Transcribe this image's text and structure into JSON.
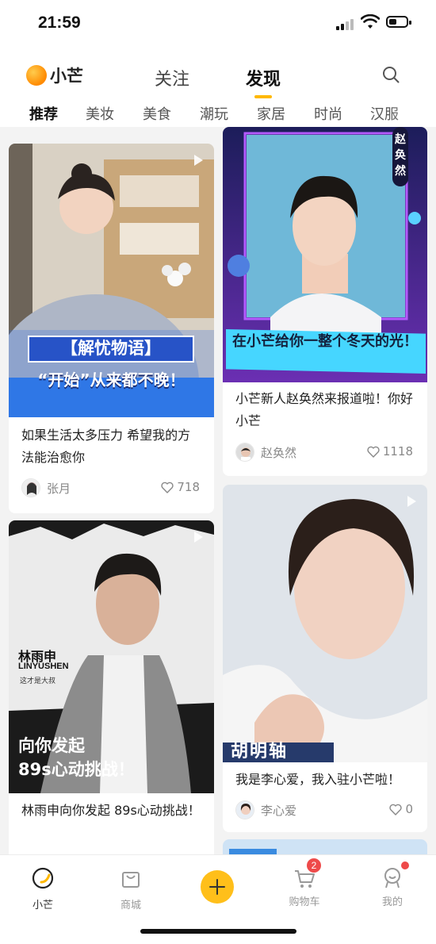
{
  "status": {
    "time": "21:59"
  },
  "app": {
    "logo_text": "小芒",
    "brand_color": "#ffb800"
  },
  "topnav": {
    "follow": "关注",
    "discover": "发现"
  },
  "categories": [
    "推荐",
    "美妆",
    "美食",
    "潮玩",
    "家居",
    "时尚",
    "汉服"
  ],
  "posts": [
    {
      "title": "如果生活太多压力 希望我的方法能治愈你",
      "user": "张月",
      "likes": "718",
      "overlay_top": "【解忧物语】",
      "overlay_bottom": "“开始”从来都不晚！"
    },
    {
      "title": "小芒新人赵奂然来报道啦！你好小芒",
      "user": "赵奂然",
      "likes": "1118",
      "overlay_side": "赵奂然",
      "overlay_bottom": "在小芒给你一整个冬天的光！"
    },
    {
      "title": "林雨申向你发起 89s心动挑战！",
      "user": "",
      "likes": "",
      "overlay_name": "林雨申",
      "overlay_en": "LINYUSHEN",
      "overlay_sub": "这才是大叔",
      "overlay_line1": "向你发起",
      "overlay_line2": "89s心动挑战！"
    },
    {
      "title": "我是李心爱，我入驻小芒啦！",
      "user": "李心爱",
      "likes": "0",
      "overlay_text": "胡明轴"
    }
  ],
  "tabbar": {
    "home": "小芒",
    "mall": "商城",
    "cart": "购物车",
    "cart_badge": "2",
    "me": "我的"
  }
}
